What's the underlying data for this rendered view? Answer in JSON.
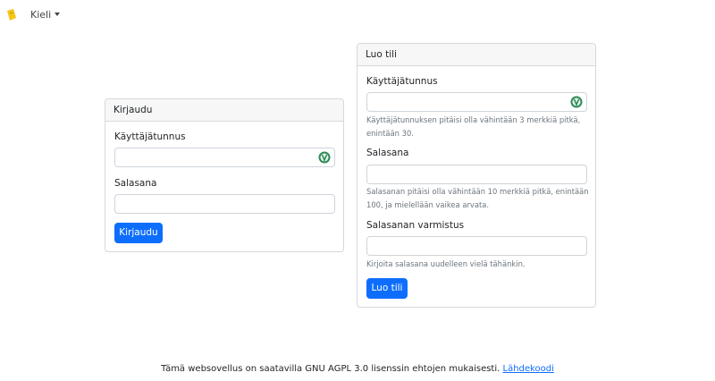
{
  "nav": {
    "language_label": "Kieli"
  },
  "login": {
    "title": "Kirjaudu",
    "username_label": "Käyttäjätunnus",
    "username_value": "",
    "password_label": "Salasana",
    "password_value": "",
    "submit_label": "Kirjaudu"
  },
  "register": {
    "title": "Luo tili",
    "username_label": "Käyttäjätunnus",
    "username_value": "",
    "username_help_1": "Käyttäjätunnuksen pitäisi olla vähintään 3 merkkiä pitkä,",
    "username_help_2": "enintään 30.",
    "password_label": "Salasana",
    "password_value": "",
    "password_help_1": "Salasanan pitäisi olla vähintään 10 merkkiä pitkä, enintään",
    "password_help_2": "100, ja mielellään vaikea arvata.",
    "confirm_label": "Salasanan varmistus",
    "confirm_value": "",
    "confirm_help": "Kirjoita salasana uudelleen vielä tähänkin.",
    "submit_label": "Luo tili"
  },
  "footer": {
    "text": "Tämä websovellus on saatavilla GNU AGPL 3.0 lisenssin ehtojen mukaisesti.",
    "link_label": "Lähdekoodi"
  },
  "colors": {
    "primary": "#0d6efd",
    "logo": "#f5c518",
    "field_icon": "#2e8b57"
  },
  "icons": {
    "logo": "app-logo-icon",
    "field": "keepass-icon",
    "dropdown": "caret-down-icon"
  }
}
